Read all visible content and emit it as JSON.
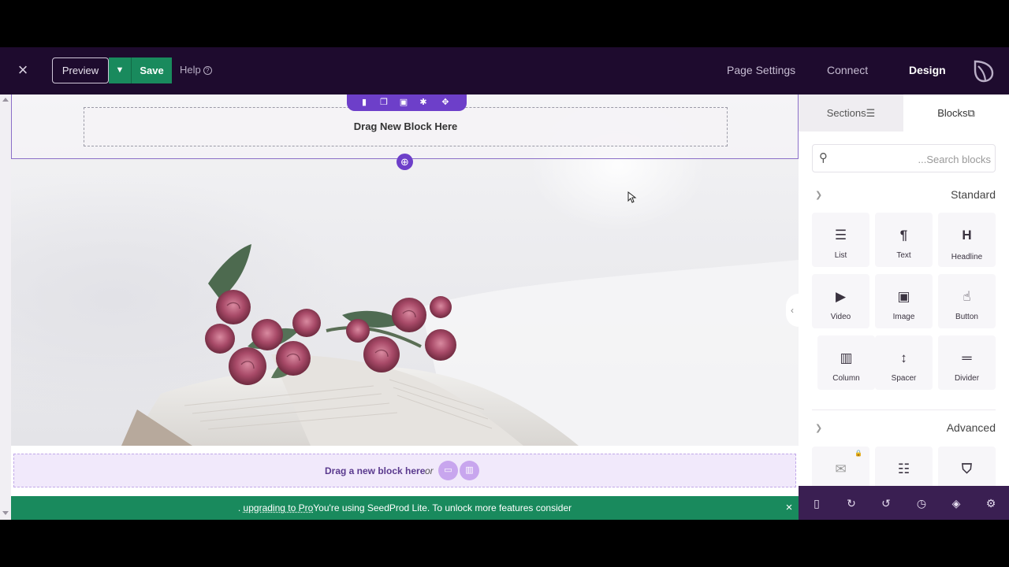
{
  "topbar": {
    "preview_label": "Preview",
    "save_label": "Save",
    "help_label": "Help",
    "nav": [
      "Page Settings",
      "Connect",
      "Design"
    ],
    "active_nav": "Design"
  },
  "canvas": {
    "drag_top_label": "Drag New Block Here",
    "drag_bottom_label": "Drag a new block here",
    "drag_bottom_or": "or",
    "banner_lead": ". ",
    "banner_link": "upgrading to Pro",
    "banner_text": "You're using SeedProd Lite. To unlock more features consider"
  },
  "panel": {
    "tabs": {
      "sections": "Sections",
      "blocks": "Blocks"
    },
    "search": {
      "placeholder": "...Search blocks"
    },
    "standard": {
      "title": "Standard",
      "items": [
        {
          "label": "List",
          "icon": "list-icon"
        },
        {
          "label": "Text",
          "icon": "paragraph-icon"
        },
        {
          "label": "Headline",
          "icon": "headline-icon"
        },
        {
          "label": "Video",
          "icon": "video-icon"
        },
        {
          "label": "Image",
          "icon": "image-icon"
        },
        {
          "label": "Button",
          "icon": "pointer-icon"
        },
        {
          "label": "Column",
          "icon": "columns-icon"
        },
        {
          "label": "Spacer",
          "icon": "spacer-icon"
        },
        {
          "label": "Divider",
          "icon": "divider-icon"
        }
      ]
    },
    "advanced": {
      "title": "Advanced",
      "items": [
        {
          "label": "",
          "icon": "envelope-icon",
          "locked": true
        },
        {
          "label": "",
          "icon": "form-icon"
        },
        {
          "label": "",
          "icon": "badge-icon"
        }
      ]
    }
  },
  "colors": {
    "topbar_bg": "#1e0b2e",
    "accent_purple": "#6d3fc9",
    "save_green": "#198a5d",
    "bottom_toolbar_bg": "#3a1f52"
  }
}
